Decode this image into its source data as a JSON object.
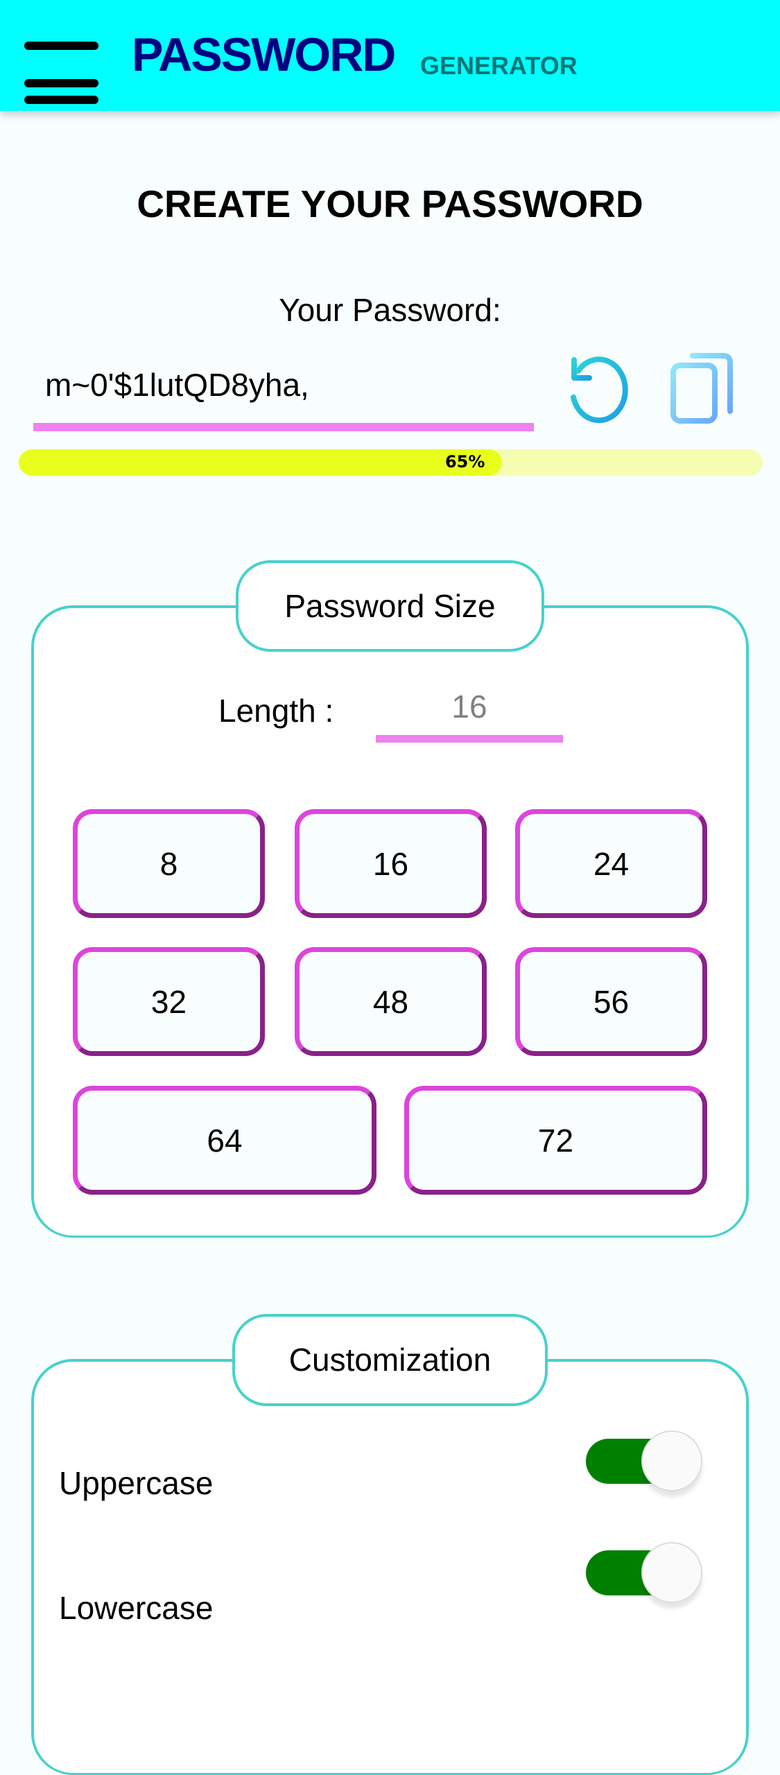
{
  "header": {
    "brand": "PASSWORD",
    "brand_sub": "GENERATOR"
  },
  "main": {
    "title": "CREATE YOUR PASSWORD",
    "password_label": "Your Password:",
    "password_value": "m~0'$1lutQD8yha,",
    "strength_percent": 65,
    "strength_label": "65%"
  },
  "size_section": {
    "legend": "Password Size",
    "length_label": "Length :",
    "length_value": "16",
    "options": [
      "8",
      "16",
      "24",
      "32",
      "48",
      "56",
      "64",
      "72"
    ]
  },
  "custom_section": {
    "legend": "Customization",
    "options": [
      {
        "label": "Uppercase",
        "enabled": true
      },
      {
        "label": "Lowercase",
        "enabled": true
      }
    ]
  },
  "colors": {
    "header": "#00ffff",
    "brand": "#000080",
    "accent_underline": "#ee82ee",
    "toggle_on": "#008000",
    "strength": "#e8ff1e"
  }
}
